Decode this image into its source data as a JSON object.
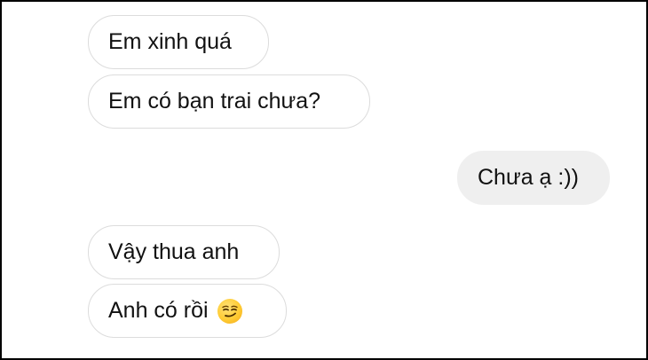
{
  "messages": [
    {
      "side": "incoming",
      "text": "Em xinh quá"
    },
    {
      "side": "incoming",
      "text": "Em có bạn trai chưa?"
    },
    {
      "side": "outgoing",
      "text": "Chưa ạ :))"
    },
    {
      "side": "incoming",
      "text": "Vậy thua anh"
    },
    {
      "side": "incoming",
      "text": "Anh có rồi",
      "emoji": "smirking-face-icon"
    }
  ],
  "colors": {
    "incoming_bg": "#ffffff",
    "incoming_border": "#dcdcdc",
    "outgoing_bg": "#efefef",
    "text": "#111111",
    "frame": "#000000"
  }
}
